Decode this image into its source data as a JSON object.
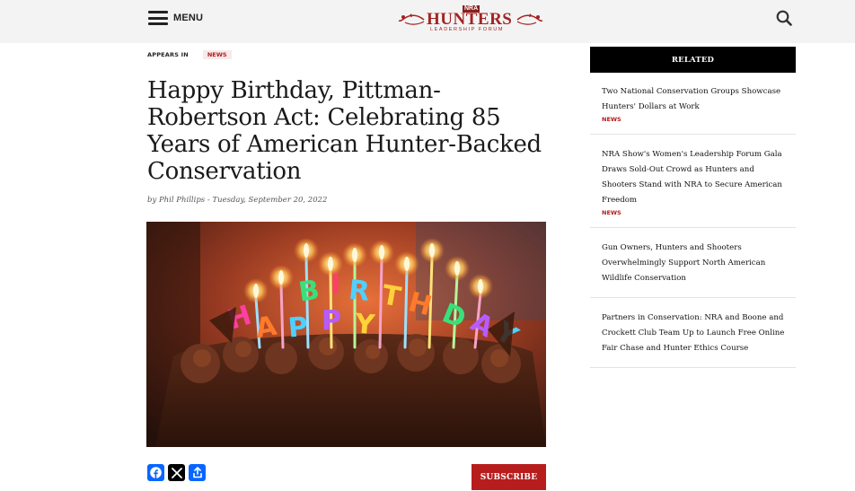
{
  "header": {
    "menu_label": "MENU",
    "logo": {
      "nra": "NRA",
      "main": "HUNTERS",
      "sub": "LEADERSHIP FORUM"
    }
  },
  "article": {
    "appears_in_label": "APPEARS IN",
    "appears_in_badge": "NEWS",
    "title": "Happy Birthday, Pittman-Robertson Act: Celebrating 85 Years of American Hunter-Backed Conservation",
    "byline": "by Phil Phillips - Tuesday, September 20, 2022",
    "subscribe_label": "SUBSCRIBE",
    "share": [
      "facebook-icon",
      "x-icon",
      "share-icon"
    ]
  },
  "sidebar": {
    "related_label": "RELATED",
    "items": [
      {
        "title": "Two National Conservation Groups Showcase Hunters' Dollars at Work",
        "tag": "NEWS"
      },
      {
        "title": "NRA Show's Women's Leadership Forum Gala Draws Sold-Out Crowd as Hunters and Shooters Stand with NRA to Secure American Freedom",
        "tag": "NEWS"
      },
      {
        "title": "Gun Owners, Hunters and Shooters Overwhelmingly Support North American Wildlife Conservation",
        "tag": ""
      },
      {
        "title": "Partners in Conservation: NRA and Boone and Crockett Club Team Up to Launch Free Online Fair Chase and Hunter Ethics Course",
        "tag": ""
      }
    ]
  },
  "colors": {
    "brand_red": "#b81d1d",
    "header_bg": "#f3f3f3",
    "related_bg": "#000000"
  }
}
